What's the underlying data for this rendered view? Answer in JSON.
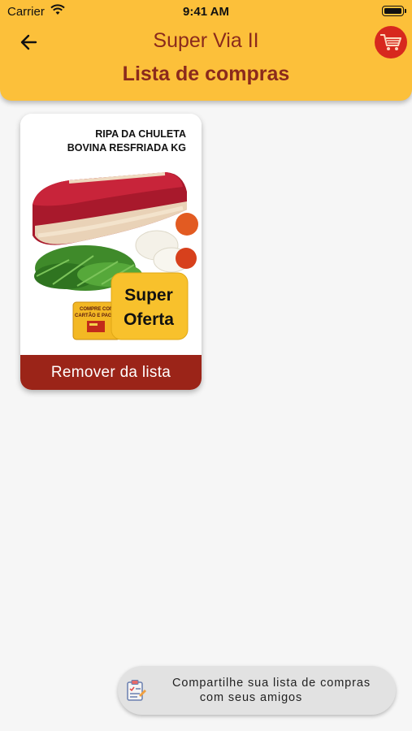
{
  "status_bar": {
    "carrier": "Carrier",
    "time": "9:41 AM"
  },
  "header": {
    "app_title": "Super Via II",
    "page_title": "Lista de compras",
    "back_icon": "arrow-left-icon",
    "cart_icon": "cart-icon",
    "background_color": "#fcc03a",
    "text_color": "#8b2a1c"
  },
  "products": [
    {
      "name_line1": "RIPA DA CHULETA",
      "name_line2": "BOVINA RESFRIADA KG",
      "badge_line1": "Super",
      "badge_line2": "Oferta",
      "promo_line1": "COMPRE COM",
      "promo_line2": "CARTÃO E PAGUE",
      "remove_label": "Remover da lista"
    }
  ],
  "share": {
    "line1": "Compartilhe sua lista de compras",
    "line2": "com seus amigos",
    "icon": "clipboard-icon"
  },
  "colors": {
    "accent_red": "#9b2418",
    "cart_red": "#d7281e",
    "badge_yellow": "#fcc03a"
  }
}
